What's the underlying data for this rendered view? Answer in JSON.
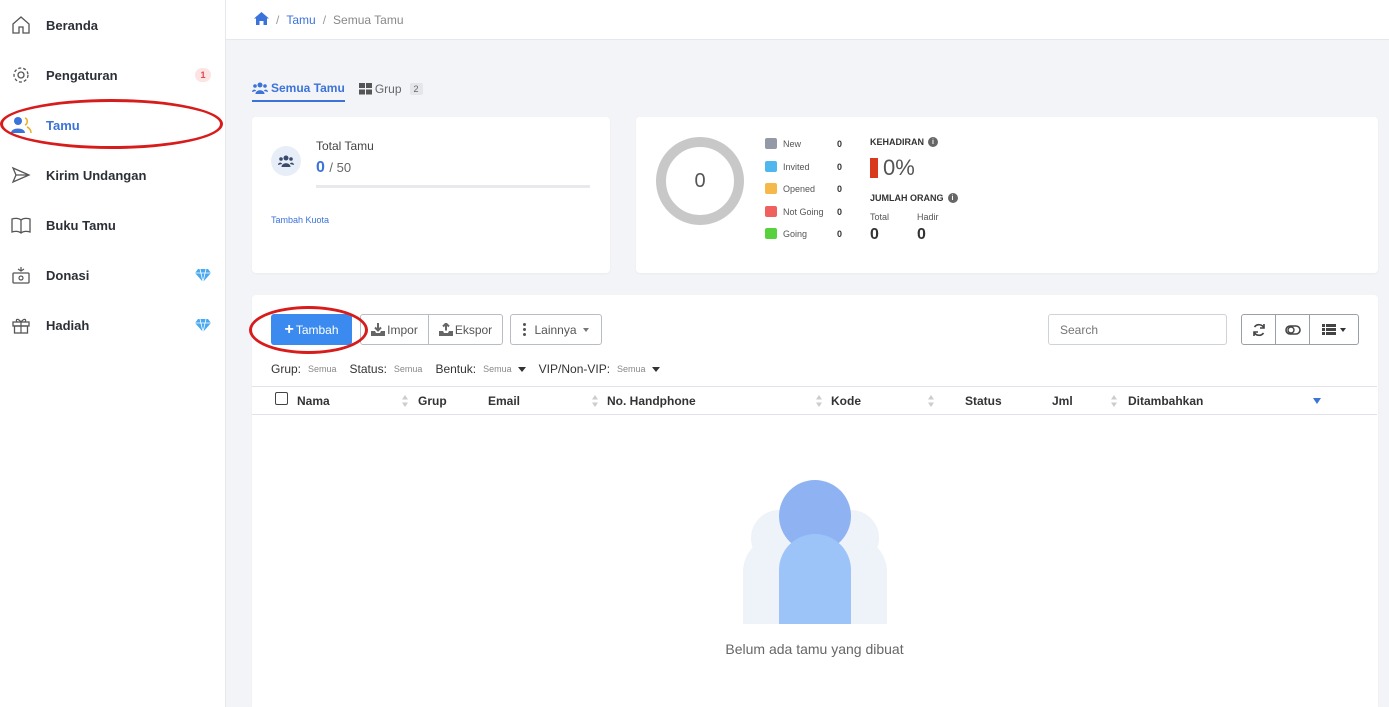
{
  "sidebar": {
    "items": [
      {
        "label": "Beranda",
        "icon": "home-icon"
      },
      {
        "label": "Pengaturan",
        "icon": "gear-icon",
        "badge": "1"
      },
      {
        "label": "Tamu",
        "icon": "guests-icon",
        "active": true
      },
      {
        "label": "Kirim Undangan",
        "icon": "send-icon"
      },
      {
        "label": "Buku Tamu",
        "icon": "book-icon"
      },
      {
        "label": "Donasi",
        "icon": "donation-icon",
        "premium": true
      },
      {
        "label": "Hadiah",
        "icon": "gift-icon",
        "premium": true
      }
    ]
  },
  "breadcrumb": {
    "link": "Tamu",
    "current": "Semua Tamu"
  },
  "tabs": {
    "all_label": "Semua Tamu",
    "group_label": "Grup",
    "group_count": "2"
  },
  "quota": {
    "title": "Total Tamu",
    "current": "0",
    "max": "/ 50",
    "fill_fraction": 0,
    "link": "Tambah Kuota"
  },
  "stats": {
    "donut_value": "0",
    "legend": [
      {
        "name": "New",
        "count": "0",
        "color": "#9499a8"
      },
      {
        "name": "Invited",
        "count": "0",
        "color": "#4fb7ee"
      },
      {
        "name": "Opened",
        "count": "0",
        "color": "#f5b94a"
      },
      {
        "name": "Not Going",
        "count": "0",
        "color": "#f0605e"
      },
      {
        "name": "Going",
        "count": "0",
        "color": "#58d13f"
      }
    ],
    "attendance_title": "KEHADIRAN",
    "attendance_value": "0%",
    "people_title": "JUMLAH ORANG",
    "total_label": "Total",
    "total_value": "0",
    "present_label": "Hadir",
    "present_value": "0"
  },
  "toolbar": {
    "add_label": "Tambah",
    "import_label": "Impor",
    "export_label": "Ekspor",
    "more_label": "Lainnya",
    "search_placeholder": "Search"
  },
  "filters": {
    "group_label": "Grup:",
    "group_value": "Semua",
    "status_label": "Status:",
    "status_value": "Semua",
    "form_label": "Bentuk:",
    "form_value": "Semua",
    "vip_label": "VIP/Non-VIP:",
    "vip_value": "Semua"
  },
  "table": {
    "columns": [
      "Nama",
      "Grup",
      "Email",
      "No. Handphone",
      "Kode",
      "Status",
      "Jml",
      "Ditambahkan"
    ]
  },
  "empty_state": {
    "text": "Belum ada tamu yang dibuat"
  },
  "colors": {
    "accent": "#3b73d9",
    "primary_button": "#3b8af0",
    "highlight": "#d81b1b",
    "attendance_bar": "#d93a1e"
  }
}
